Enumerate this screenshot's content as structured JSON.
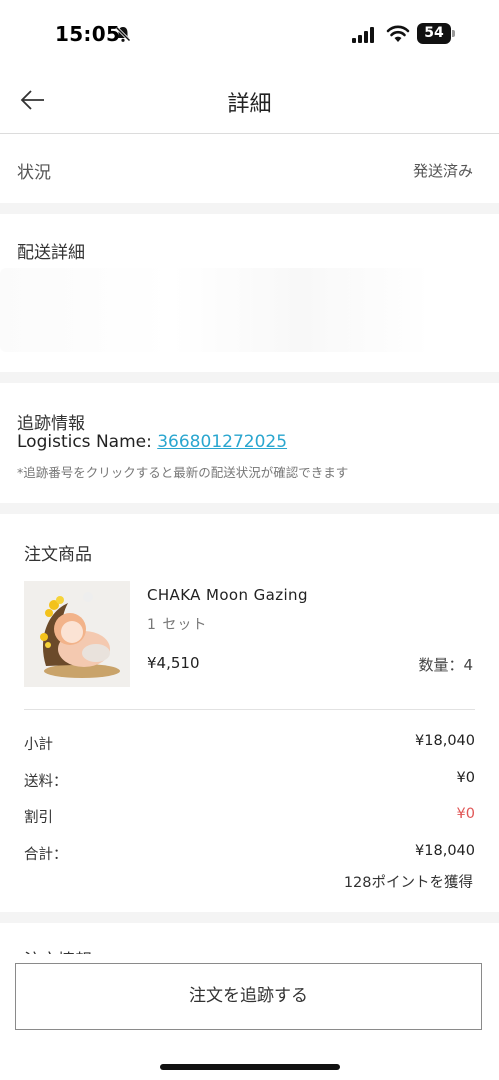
{
  "status_bar": {
    "time": "15:05",
    "battery": "54",
    "icons": [
      "bell-slash-icon",
      "signal-icon",
      "wifi-icon",
      "battery-icon"
    ]
  },
  "nav": {
    "title": "詳細",
    "back_icon": "back-arrow-icon"
  },
  "status": {
    "label": "状況",
    "value": "発送済み"
  },
  "delivery": {
    "title": "配送詳細"
  },
  "tracking": {
    "title": "追跡情報",
    "logistics_label": "Logistics Name: ",
    "tracking_number": "366801272025",
    "note": "*追跡番号をクリックすると最新の配送状況が確認できます",
    "link_color": "#2aa6cf"
  },
  "order": {
    "title": "注文商品",
    "product": {
      "name": "CHAKA Moon Gazing",
      "variant": "1 セット",
      "price": "¥4,510",
      "quantity": "数量：4"
    },
    "summary": [
      {
        "label": "小計",
        "value": "¥18,040"
      },
      {
        "label": "送料：",
        "value": "¥0"
      },
      {
        "label": "割引",
        "value": "¥0"
      },
      {
        "label": "合計：",
        "value": "¥18,040"
      }
    ],
    "points": "128ポイントを獲得",
    "discount_color": "#e05656"
  },
  "next_section": {
    "title_partial": "注文情報"
  },
  "footer": {
    "track_button": "注文を追跡する"
  }
}
